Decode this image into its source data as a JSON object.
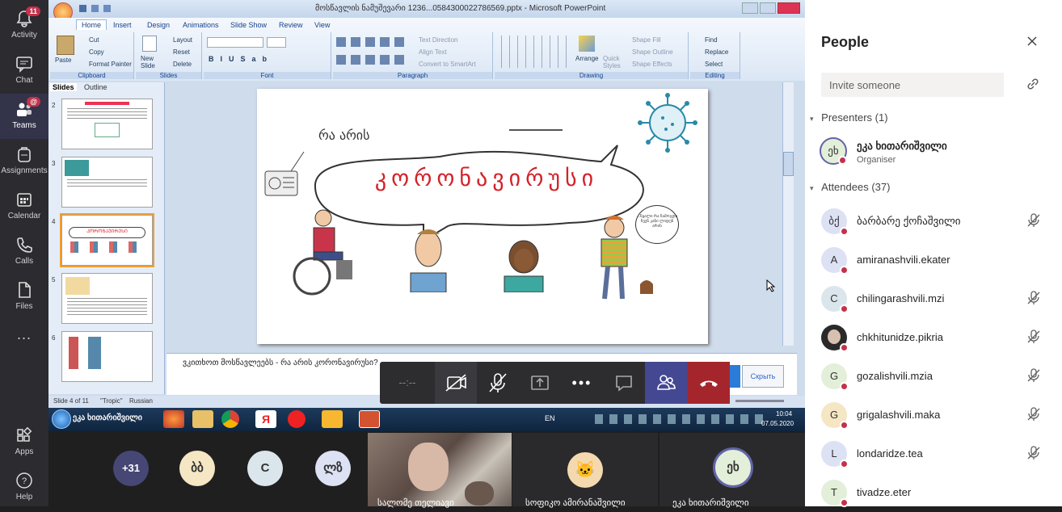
{
  "rail": {
    "items": [
      {
        "label": "Activity",
        "badge": "11"
      },
      {
        "label": "Chat"
      },
      {
        "label": "Teams",
        "badge": "@"
      },
      {
        "label": "Assignments"
      },
      {
        "label": "Calendar"
      },
      {
        "label": "Calls"
      },
      {
        "label": "Files"
      },
      {
        "label": "..."
      }
    ],
    "apps": "Apps",
    "help": "Help"
  },
  "ppt": {
    "title": "მოსწავლის ნამუშევარი 1236...0584300022786569.pptx - Microsoft PowerPoint",
    "tabs": [
      "Home",
      "Insert",
      "Design",
      "Animations",
      "Slide Show",
      "Review",
      "View"
    ],
    "clipboard": {
      "paste": "Paste",
      "cut": "Cut",
      "copy": "Copy",
      "format_painter": "Format Painter",
      "label": "Clipboard"
    },
    "slides_group": {
      "new_slide": "New Slide",
      "layout": "Layout",
      "reset": "Reset",
      "delete": "Delete",
      "label": "Slides"
    },
    "font": {
      "label": "Font"
    },
    "paragraph": {
      "text_direction": "Text Direction",
      "align_text": "Align Text",
      "convert": "Convert to SmartArt",
      "label": "Paragraph"
    },
    "drawing": {
      "arrange": "Arrange",
      "quick_styles": "Quick Styles",
      "shape_fill": "Shape Fill",
      "shape_outline": "Shape Outline",
      "shape_effects": "Shape Effects",
      "label": "Drawing"
    },
    "editing": {
      "find": "Find",
      "replace": "Replace",
      "select": "Select",
      "label": "Editing"
    },
    "pane_tabs": [
      "Slides",
      "Outline"
    ],
    "thumb_numbers": [
      "2",
      "3",
      "4",
      "5",
      "6"
    ],
    "slide": {
      "question": "რა არის",
      "bubble": "კორონავირუსი",
      "small_bubble": "...წყალი რა ჩამოგდი ჩვენ კანი ლიდენ არის"
    },
    "notes": "ვკითხოთ მოსწავლეებს - რა არის კორონავირუსი?",
    "status": {
      "slide": "Slide 4 of 11",
      "theme": "\"Tropic\"",
      "lang": "Russian"
    },
    "taskbar": {
      "lang": "EN",
      "time": "10:04",
      "date": "07.05.2020",
      "user": "ეკა ხითარიშვილი"
    },
    "popup": {
      "btn2": "Скрыть"
    }
  },
  "call": {
    "timer": "--:--"
  },
  "strip": [
    {
      "label": "+31",
      "color": "#464775",
      "text": "#ffffff"
    },
    {
      "label": "ბბ",
      "color": "#f5e6c4",
      "text": "#333333"
    },
    {
      "label": "C",
      "color": "#dbe6ec",
      "text": "#333333"
    },
    {
      "label": "ლზ",
      "color": "#dde1f4",
      "text": "#333333"
    }
  ],
  "strip_names": {
    "video1": "სალომე თელიავი",
    "video2": "სოფიკო ამირანაშვილი",
    "presenter": "ეკა ხითარიშვილი",
    "presenter_initials": "ეხ"
  },
  "people": {
    "title": "People",
    "invite": "Invite someone",
    "presenters_label": "Presenters (1)",
    "presenter": {
      "initials": "ეხ",
      "name": "ეკა ხითარიშვილი",
      "role": "Organiser"
    },
    "attendees_label": "Attendees (37)",
    "attendees": [
      {
        "initials": "ბქ",
        "name": "ბარბარე ქოჩაშვილი",
        "color": "#dde1f4",
        "muted": true
      },
      {
        "initials": "A",
        "name": "amiranashvili.ekater",
        "color": "#dde1f4",
        "muted": false
      },
      {
        "initials": "C",
        "name": "chilingarashvili.mzi",
        "color": "#dbe6ec",
        "muted": true
      },
      {
        "initials": "",
        "name": "chkhitunidze.pikria",
        "color": "#2a2a2a",
        "muted": true
      },
      {
        "initials": "G",
        "name": "gozalishvili.mzia",
        "color": "#e3efd9",
        "muted": true
      },
      {
        "initials": "G",
        "name": "grigalashvili.maka",
        "color": "#f5e6c4",
        "muted": true
      },
      {
        "initials": "L",
        "name": "londaridze.tea",
        "color": "#dde1f4",
        "muted": true
      },
      {
        "initials": "T",
        "name": "tivadze.eter",
        "color": "#e3efd9",
        "muted": false
      }
    ]
  }
}
